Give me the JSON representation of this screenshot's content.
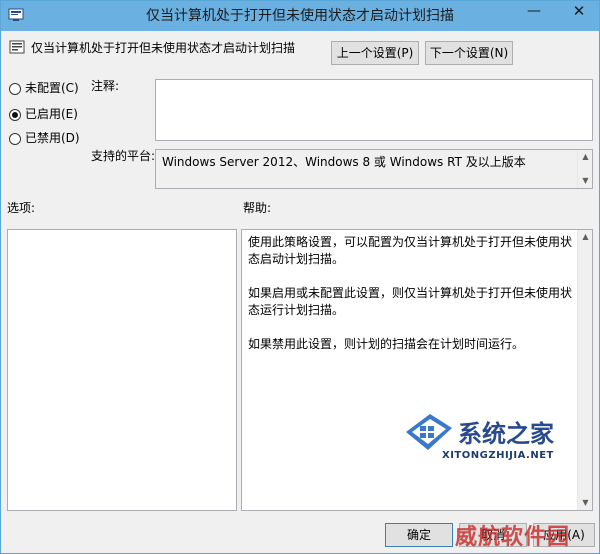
{
  "window": {
    "title": "仅当计算机处于打开但未使用状态才启动计划扫描",
    "minimize_glyph": "—",
    "maximize_glyph": "☐",
    "close_glyph": "✕"
  },
  "header": {
    "policy_name": "仅当计算机处于打开但未使用状态才启动计划扫描",
    "prev_label": "上一个设置(P)",
    "next_label": "下一个设置(N)"
  },
  "state_options": [
    {
      "label": "未配置(C)",
      "selected": false
    },
    {
      "label": "已启用(E)",
      "selected": true
    },
    {
      "label": "已禁用(D)",
      "selected": false
    }
  ],
  "comment": {
    "label": "注释:",
    "value": ""
  },
  "platform": {
    "label": "支持的平台:",
    "value": "Windows Server 2012、Windows 8 或 Windows RT 及以上版本"
  },
  "options": {
    "label": "选项:"
  },
  "help": {
    "label": "帮助:",
    "paragraphs": [
      "使用此策略设置，可以配置为仅当计算机处于打开但未使用状态启动计划扫描。",
      "如果启用或未配置此设置，则仅当计算机处于打开但未使用状态运行计划扫描。",
      "如果禁用此设置，则计划的扫描会在计划时间运行。"
    ]
  },
  "footer": {
    "ok_label": "确定",
    "cancel_label": "取消",
    "apply_label": "应用(A)"
  },
  "watermark": {
    "line1": "系统之家",
    "line2": "XITONGZHIJIA.NET",
    "stamp": "威航软件园"
  },
  "colors": {
    "titlebar": "#6ab0e1",
    "window_border": "#59a7d8",
    "dialog_bg": "#f0f0f0"
  }
}
